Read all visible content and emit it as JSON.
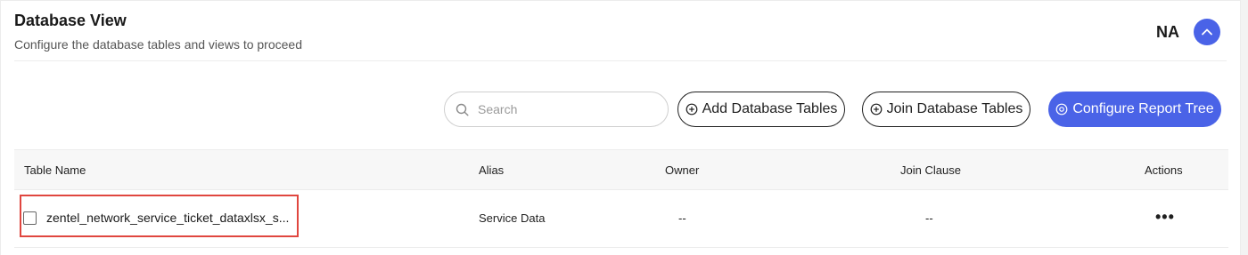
{
  "header": {
    "title": "Database View",
    "subtitle": "Configure the database tables and views to proceed",
    "status": "NA"
  },
  "toolbar": {
    "search_placeholder": "Search",
    "add_label": "Add Database Tables",
    "join_label": "Join Database Tables",
    "configure_label": "Configure Report Tree"
  },
  "table": {
    "columns": [
      "Table Name",
      "Alias",
      "Owner",
      "Join Clause",
      "Actions"
    ],
    "rows": [
      {
        "table_name": "zentel_network_service_ticket_dataxlsx_s...",
        "alias": "Service Data",
        "owner": "--",
        "join_clause": "--",
        "actions": "•••"
      }
    ]
  },
  "colors": {
    "accent": "#4a63e7",
    "highlight": "#e0463f"
  }
}
